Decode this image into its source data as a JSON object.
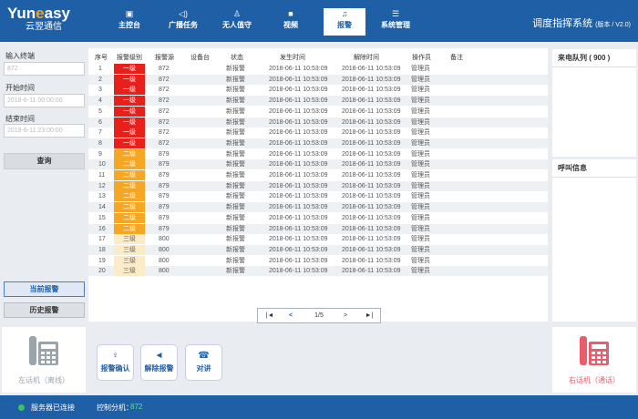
{
  "header": {
    "logo_main_a": "Yun",
    "logo_main_e": "e",
    "logo_main_b": "asy",
    "logo_sub": "云翌通信",
    "system_title": "调度指挥系统",
    "version": "(版本 / V2.0)",
    "nav": [
      {
        "label": "主控台",
        "icon": "desk-icon"
      },
      {
        "label": "广播任务",
        "icon": "speaker-icon"
      },
      {
        "label": "无人值守",
        "icon": "person-icon"
      },
      {
        "label": "视频",
        "icon": "video-icon"
      },
      {
        "label": "报警",
        "icon": "bell-icon"
      },
      {
        "label": "系统管理",
        "icon": "list-icon"
      }
    ],
    "active_nav": "报警"
  },
  "filters": {
    "terminal_label": "输入终端",
    "terminal_value": "872",
    "start_label": "开始时间",
    "start_value": "2018-6-11 00:00:00",
    "end_label": "结束时间",
    "end_value": "2018-6-11 23:00:00",
    "query_label": "查询"
  },
  "side_buttons": {
    "current": "当前报警",
    "history": "历史报警"
  },
  "table": {
    "headers": [
      "序号",
      "报警级别",
      "报警源",
      "设备台",
      "状态",
      "发生时间",
      "解除时间",
      "操作员",
      "备注"
    ],
    "rows": [
      {
        "no": "1",
        "level": "一级",
        "source": "872",
        "status": "新报警",
        "start": "2018-06-11  10:53:09",
        "end": "2018-06-11  10:53:09",
        "operator": "管理员"
      },
      {
        "no": "2",
        "level": "一级",
        "source": "872",
        "status": "新报警",
        "start": "2018-06-11  10:53:09",
        "end": "2018-06-11  10:53:09",
        "operator": "管理员"
      },
      {
        "no": "3",
        "level": "一级",
        "source": "872",
        "status": "新报警",
        "start": "2018-06-11  10:53:09",
        "end": "2018-06-11  10:53:09",
        "operator": "管理员"
      },
      {
        "no": "4",
        "level": "一级",
        "source": "872",
        "status": "新报警",
        "start": "2018-06-11  10:53:09",
        "end": "2018-06-11  10:53:09",
        "operator": "管理员"
      },
      {
        "no": "5",
        "level": "一级",
        "source": "872",
        "status": "新报警",
        "start": "2018-06-11  10:53:09",
        "end": "2018-06-11  10:53:09",
        "operator": "管理员"
      },
      {
        "no": "6",
        "level": "一级",
        "source": "872",
        "status": "新报警",
        "start": "2018-06-11  10:53:09",
        "end": "2018-06-11  10:53:09",
        "operator": "管理员"
      },
      {
        "no": "7",
        "level": "一级",
        "source": "872",
        "status": "新报警",
        "start": "2018-06-11  10:53:09",
        "end": "2018-06-11  10:53:09",
        "operator": "管理员"
      },
      {
        "no": "8",
        "level": "一级",
        "source": "872",
        "status": "新报警",
        "start": "2018-06-11  10:53:09",
        "end": "2018-06-11  10:53:09",
        "operator": "管理员"
      },
      {
        "no": "9",
        "level": "二级",
        "source": "879",
        "status": "新报警",
        "start": "2018-06-11  10:53:09",
        "end": "2018-06-11  10:53:09",
        "operator": "管理员"
      },
      {
        "no": "10",
        "level": "二级",
        "source": "879",
        "status": "新报警",
        "start": "2018-06-11  10:53:09",
        "end": "2018-06-11  10:53:09",
        "operator": "管理员"
      },
      {
        "no": "11",
        "level": "二级",
        "source": "879",
        "status": "新报警",
        "start": "2018-06-11  10:53:09",
        "end": "2018-06-11  10:53:09",
        "operator": "管理员"
      },
      {
        "no": "12",
        "level": "二级",
        "source": "879",
        "status": "新报警",
        "start": "2018-06-11  10:53:09",
        "end": "2018-06-11  10:53:09",
        "operator": "管理员"
      },
      {
        "no": "13",
        "level": "二级",
        "source": "879",
        "status": "新报警",
        "start": "2018-06-11  10:53:09",
        "end": "2018-06-11  10:53:09",
        "operator": "管理员"
      },
      {
        "no": "14",
        "level": "二级",
        "source": "879",
        "status": "新报警",
        "start": "2018-06-11  10:53:09",
        "end": "2018-06-11  10:53:09",
        "operator": "管理员"
      },
      {
        "no": "15",
        "level": "二级",
        "source": "879",
        "status": "新报警",
        "start": "2018-06-11  10:53:09",
        "end": "2018-06-11  10:53:09",
        "operator": "管理员"
      },
      {
        "no": "16",
        "level": "二级",
        "source": "879",
        "status": "新报警",
        "start": "2018-06-11  10:53:09",
        "end": "2018-06-11  10:53:09",
        "operator": "管理员"
      },
      {
        "no": "17",
        "level": "三级",
        "source": "800",
        "status": "新报警",
        "start": "2018-06-11  10:53:09",
        "end": "2018-06-11  10:53:09",
        "operator": "管理员"
      },
      {
        "no": "18",
        "level": "三级",
        "source": "800",
        "status": "新报警",
        "start": "2018-06-11  10:53:09",
        "end": "2018-06-11  10:53:09",
        "operator": "管理员"
      },
      {
        "no": "19",
        "level": "三级",
        "source": "800",
        "status": "新报警",
        "start": "2018-06-11  10:53:09",
        "end": "2018-06-11  10:53:09",
        "operator": "管理员"
      },
      {
        "no": "20",
        "level": "三级",
        "source": "800",
        "status": "新报警",
        "start": "2018-06-11  10:53:09",
        "end": "2018-06-11  10:53:09",
        "operator": "管理员"
      }
    ],
    "level_colors": {
      "一级": "#e8201c",
      "二级": "#f5a623",
      "三级": "#fbebc6"
    }
  },
  "pager": {
    "first": "|◄",
    "prev": "<",
    "page": "1/5",
    "next": ">",
    "last": "►|"
  },
  "right": {
    "queue_title": "来电队列 ( 900 )",
    "callinfo_title": "呼叫信息"
  },
  "phones": {
    "left_label": "左话机（离线）",
    "left_color": "#9aa4ad",
    "right_label": "右话机（通话）",
    "right_color": "#e85c6c"
  },
  "actions": [
    {
      "label": "报警确认",
      "icon": "pin-icon"
    },
    {
      "label": "解除报警",
      "icon": "megaphone-icon"
    },
    {
      "label": "对讲",
      "icon": "handset-icon"
    }
  ],
  "footer": {
    "server_status": "服务器已连接",
    "extension_label": "控制分机：",
    "extension_value": "872"
  }
}
